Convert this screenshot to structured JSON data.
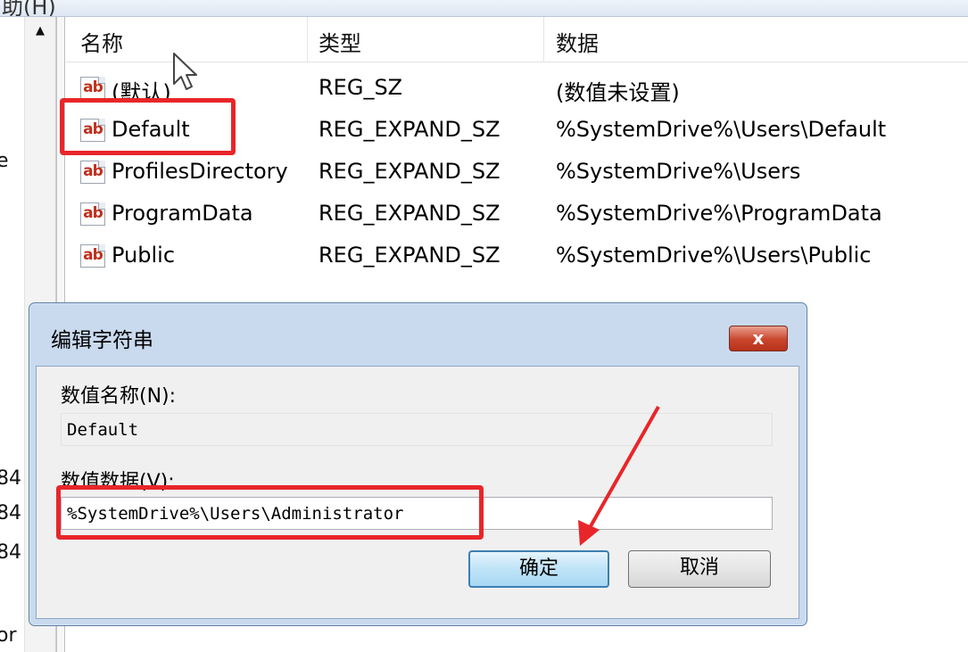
{
  "menu": {
    "partial_label": "助(H)"
  },
  "left_pane": {
    "fragments": [
      "e",
      "84",
      "84",
      "84",
      "or"
    ]
  },
  "list": {
    "columns": [
      "名称",
      "类型",
      "数据"
    ],
    "rows": [
      {
        "name": "(默认)",
        "type": "REG_SZ",
        "data": "(数值未设置)"
      },
      {
        "name": "Default",
        "type": "REG_EXPAND_SZ",
        "data": "%SystemDrive%\\Users\\Default"
      },
      {
        "name": "ProfilesDirectory",
        "type": "REG_EXPAND_SZ",
        "data": "%SystemDrive%\\Users"
      },
      {
        "name": "ProgramData",
        "type": "REG_EXPAND_SZ",
        "data": "%SystemDrive%\\ProgramData"
      },
      {
        "name": "Public",
        "type": "REG_EXPAND_SZ",
        "data": "%SystemDrive%\\Users\\Public"
      }
    ],
    "icon_text": "ab"
  },
  "dialog": {
    "title": "编辑字符串",
    "close_label": "x",
    "value_name_label": "数值名称(N):",
    "value_name": "Default",
    "value_data_label": "数值数据(V):",
    "value_data": "%SystemDrive%\\Users\\Administrator",
    "ok_label": "确定",
    "cancel_label": "取消"
  },
  "colors": {
    "highlight": "#e8262a",
    "dialog_frame": "#c9daef"
  }
}
